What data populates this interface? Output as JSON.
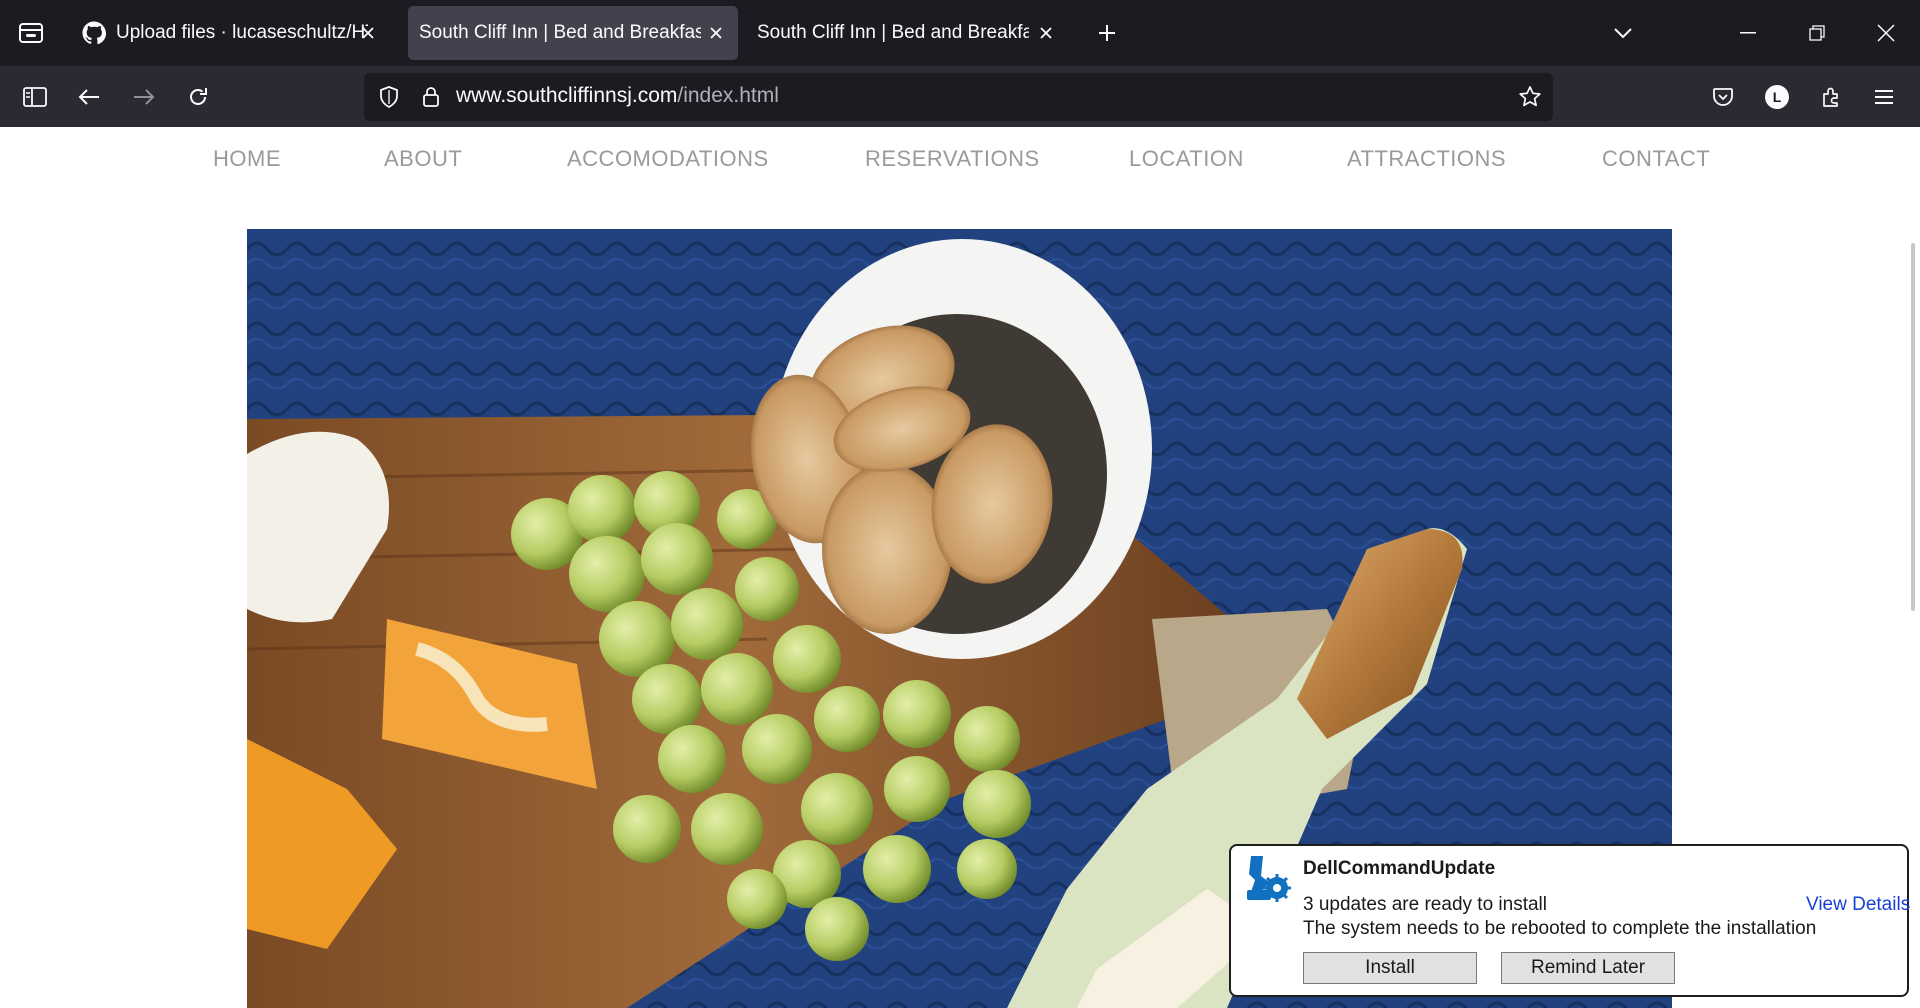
{
  "browser": {
    "tabs": [
      {
        "title": "Upload files · lucaseschultz/HTTP",
        "icon": "github-icon",
        "active": false
      },
      {
        "title": "South Cliff Inn | Bed and Breakfast |",
        "icon": "",
        "active": true
      },
      {
        "title": "South Cliff Inn | Bed and Breakfast |",
        "icon": "",
        "active": false
      }
    ],
    "url": {
      "host": "www.southcliffinnsj.com",
      "path": "/index.html"
    },
    "profile_initial": "L",
    "colors": {
      "tabbar": "#1c1b22",
      "toolbar": "#2b2a33",
      "active_tab": "#42414d"
    }
  },
  "site": {
    "nav": [
      "HOME",
      "ABOUT",
      "ACCOMODATIONS",
      "RESERVATIONS",
      "LOCATION",
      "ATTRACTIONS",
      "CONTACT"
    ],
    "nav_color": "#9a9a9a"
  },
  "notification": {
    "app": "DellCommandUpdate",
    "line1": "3 updates are ready to install",
    "line2": "The system needs to be rebooted to complete the installation",
    "link": "View Details",
    "install_label": "Install",
    "remind_label": "Remind Later",
    "icon": "dell-update-icon"
  }
}
